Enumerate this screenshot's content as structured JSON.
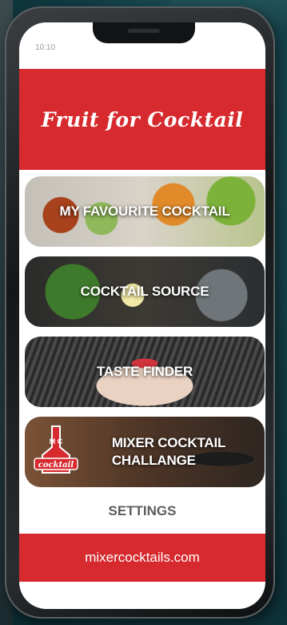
{
  "status_bar": {
    "time": "10:10"
  },
  "header": {
    "title": "Fruit for Cocktail"
  },
  "menu": [
    {
      "label": "MY FAVOURITE COCKTAIL"
    },
    {
      "label": "COCKTAIL SOURCE"
    },
    {
      "label": "TASTE FINDER"
    },
    {
      "label_line1": "MIXER COCKTAIL",
      "label_line2": "CHALLANGE",
      "badge_top": "M C",
      "badge_word": "cocktail"
    }
  ],
  "settings": {
    "label": "SETTINGS"
  },
  "footer": {
    "url": "mixercocktails.com"
  },
  "colors": {
    "brand_red": "#d62a2f",
    "settings_grey": "#5c5c5c"
  }
}
